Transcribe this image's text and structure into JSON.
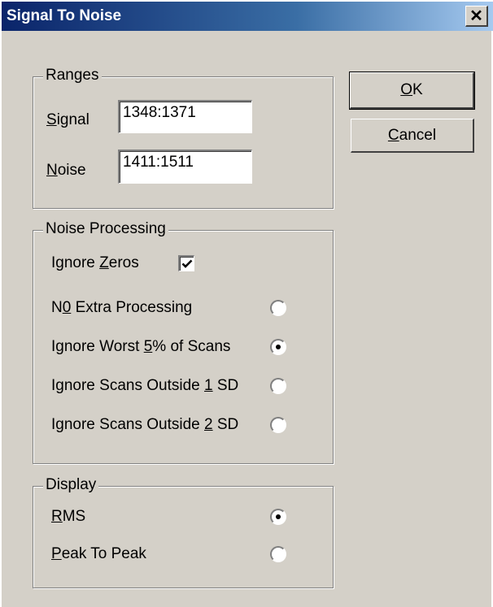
{
  "window": {
    "title": "Signal To Noise"
  },
  "ranges": {
    "legend": "Ranges",
    "signal_label": {
      "pre": "",
      "mnemonic": "S",
      "post": "ignal"
    },
    "signal_value": "1348:1371",
    "noise_label": {
      "pre": "",
      "mnemonic": "N",
      "post": "oise"
    },
    "noise_value": "1411:1511"
  },
  "noise_processing": {
    "legend": "Noise Processing",
    "ignore_zeros": {
      "pre": "Ignore ",
      "mnemonic": "Z",
      "post": "eros",
      "checked": true
    },
    "options": [
      {
        "pre": "N",
        "mnemonic": "0",
        "post": " Extra Processing",
        "selected": false
      },
      {
        "pre": "Ignore Worst ",
        "mnemonic": "5",
        "post": "% of Scans",
        "selected": true
      },
      {
        "pre": "Ignore Scans Outside ",
        "mnemonic": "1",
        "post": " SD",
        "selected": false
      },
      {
        "pre": "Ignore Scans Outside ",
        "mnemonic": "2",
        "post": " SD",
        "selected": false
      }
    ]
  },
  "display": {
    "legend": "Display",
    "options": [
      {
        "pre": "",
        "mnemonic": "R",
        "post": "MS",
        "selected": true
      },
      {
        "pre": "",
        "mnemonic": "P",
        "post": "eak To Peak",
        "selected": false
      }
    ]
  },
  "buttons": {
    "ok": {
      "pre": "",
      "mnemonic": "O",
      "post": "K"
    },
    "cancel": {
      "pre": "",
      "mnemonic": "C",
      "post": "ancel"
    }
  }
}
